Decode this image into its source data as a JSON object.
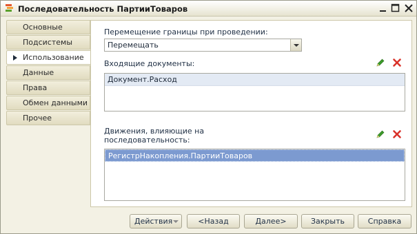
{
  "window": {
    "title": "Последовательность ПартииТоваров",
    "icon": "sequence-icon",
    "controls": [
      "minimize-icon",
      "maximize-icon",
      "close-icon"
    ]
  },
  "tabs": [
    {
      "label": "Основные",
      "active": false
    },
    {
      "label": "Подсистемы",
      "active": false
    },
    {
      "label": "Использование",
      "active": true
    },
    {
      "label": "Данные",
      "active": false
    },
    {
      "label": "Права",
      "active": false
    },
    {
      "label": "Обмен данными",
      "active": false
    },
    {
      "label": "Прочее",
      "active": false
    }
  ],
  "usage": {
    "boundary_label": "Перемещение границы при проведении:",
    "boundary_value": "Перемещать",
    "incoming_label": "Входящие  документы:",
    "incoming_items": [
      "Документ.Расход"
    ],
    "movements_label_line1": "Движения, влияющие на",
    "movements_label_line2": "последовательность:",
    "movements_items": [
      "РегистрНакопления.ПартииТоваров"
    ]
  },
  "icons": {
    "edit": "pencil-icon",
    "delete": "delete-x-icon",
    "edit_color": "#3c9a2a",
    "delete_color": "#d9322a"
  },
  "footer": {
    "actions": "Действия",
    "back": "<Назад",
    "next": "Далее>",
    "close": "Закрыть",
    "help": "Справка"
  }
}
